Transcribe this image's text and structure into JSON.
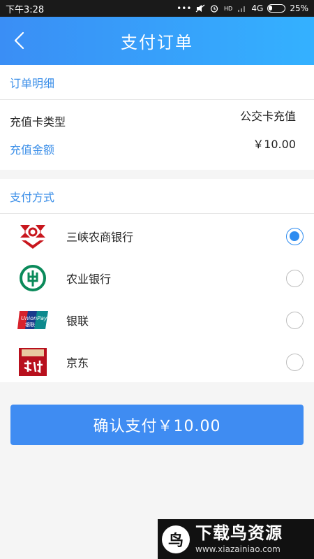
{
  "status_bar": {
    "time": "下午3:28",
    "dots": "•••",
    "network": "4G",
    "battery_text": "25%",
    "battery_level": 0.25
  },
  "header": {
    "title": "支付订单"
  },
  "order": {
    "header": "订单明细",
    "card_type_label": "充值卡类型",
    "card_type_value": "公交卡充值",
    "amount_label": "充值金额",
    "amount_value": "￥10.00"
  },
  "payment": {
    "header": "支付方式",
    "methods": [
      {
        "name": "三峡农商银行",
        "icon": "sanxia-bank-logo-icon",
        "selected": true
      },
      {
        "name": "农业银行",
        "icon": "abc-bank-logo-icon",
        "selected": false
      },
      {
        "name": "银联",
        "icon": "unionpay-logo-icon",
        "selected": false
      },
      {
        "name": "京东",
        "icon": "jd-pay-logo-icon",
        "selected": false
      }
    ]
  },
  "confirm": {
    "label": "确认支付￥10.00"
  },
  "watermark": {
    "title": "下载鸟资源",
    "url": "www.xiazainiao.com",
    "logo_glyph": "鸟"
  },
  "colors": {
    "primary": "#3f8cf2",
    "label_blue": "#3a8ee8",
    "radio_on": "#2e8cf0"
  }
}
